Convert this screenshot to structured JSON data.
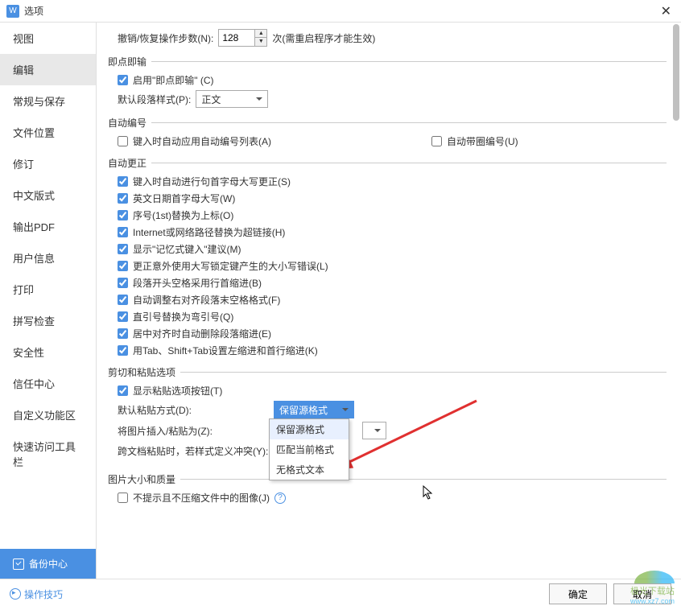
{
  "titlebar": {
    "title": "选项"
  },
  "sidebar": {
    "items": [
      {
        "label": "视图"
      },
      {
        "label": "编辑",
        "active": true
      },
      {
        "label": "常规与保存"
      },
      {
        "label": "文件位置"
      },
      {
        "label": "修订"
      },
      {
        "label": "中文版式"
      },
      {
        "label": "输出PDF"
      },
      {
        "label": "用户信息"
      },
      {
        "label": "打印"
      },
      {
        "label": "拼写检查"
      },
      {
        "label": "安全性"
      },
      {
        "label": "信任中心"
      },
      {
        "label": "自定义功能区"
      },
      {
        "label": "快速访问工具栏"
      }
    ],
    "backup": "备份中心"
  },
  "undo": {
    "label": "撤销/恢复操作步数(N):",
    "value": "128",
    "suffix": "次(需重启程序才能生效)"
  },
  "groups": {
    "click_type": "即点即输",
    "auto_number": "自动编号",
    "auto_correct": "自动更正",
    "paste_opts": "剪切和粘贴选项",
    "img_quality": "图片大小和质量"
  },
  "click_type": {
    "enable": "启用\"即点即输\" (C)",
    "style_label": "默认段落样式(P):",
    "style_value": "正文"
  },
  "auto_number": {
    "apply_list": "键入时自动应用自动编号列表(A)",
    "circle_num": "自动带圈编号(U)"
  },
  "auto_correct": {
    "cap_first": "键入时自动进行句首字母大写更正(S)",
    "date_cap": "英文日期首字母大写(W)",
    "ordinal": "序号(1st)替换为上标(O)",
    "internet": "Internet或网络路径替换为超链接(H)",
    "memory": "显示\"记忆式键入\"建议(M)",
    "capslock": "更正意外使用大写锁定键产生的大小写错误(L)",
    "indent_space": "段落开头空格采用行首缩进(B)",
    "adjust_space": "自动调整右对齐段落末空格格式(F)",
    "quotes": "直引号替换为弯引号(Q)",
    "center": "居中对齐时自动删除段落缩进(E)",
    "tab": "用Tab、Shift+Tab设置左缩进和首行缩进(K)"
  },
  "paste": {
    "show_btn": "显示粘贴选项按钮(T)",
    "default_label": "默认粘贴方式(D):",
    "default_value": "保留源格式",
    "dropdown": {
      "opt1": "保留源格式",
      "opt2": "匹配当前格式",
      "opt3": "无格式文本"
    },
    "insert_img_label": "将图片插入/粘贴为(Z):",
    "cross_doc": "跨文档粘贴时，若样式定义冲突(Y):"
  },
  "img": {
    "no_compress": "不提示且不压缩文件中的图像(J)"
  },
  "footer": {
    "tips": "操作技巧",
    "ok": "确定",
    "cancel": "取消"
  },
  "watermark": {
    "line1": "极光下载站",
    "line2": "www.xz7.com"
  }
}
